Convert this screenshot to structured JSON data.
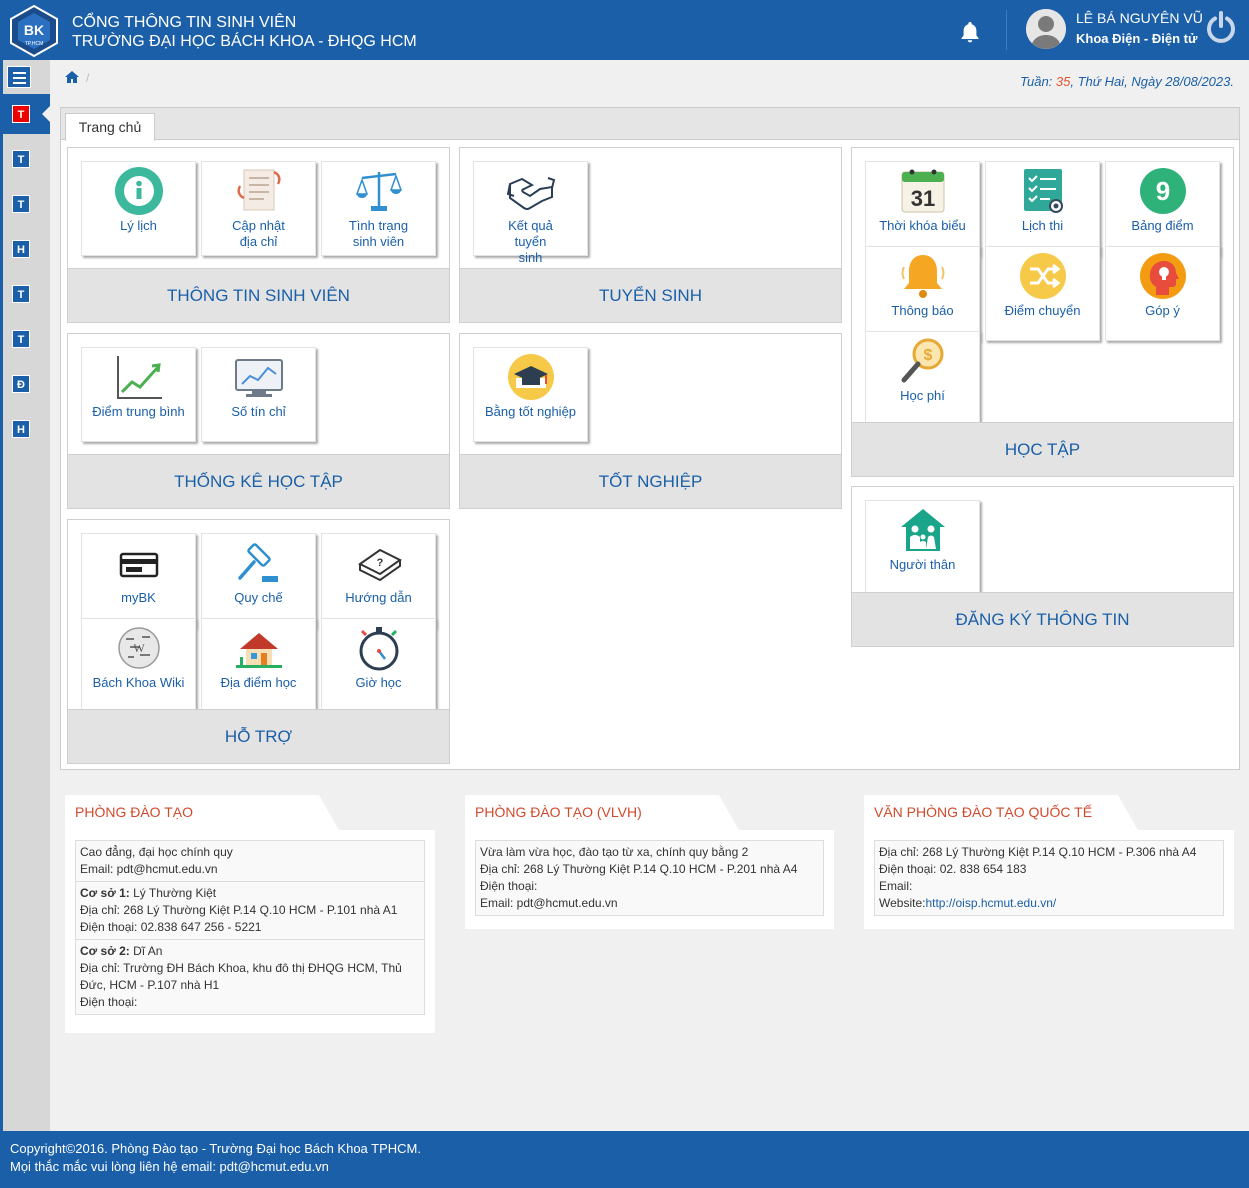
{
  "header": {
    "title_line1": "CỔNG THÔNG TIN SINH VIÊN",
    "title_line2": "TRƯỜNG ĐẠI HỌC BÁCH KHOA - ĐHQG HCM",
    "logo_text": "BK",
    "logo_sub": "TP.HCM",
    "user_name": "LÊ BÁ NGUYÊN VŨ",
    "user_dept": "Khoa Điện - Điện tử"
  },
  "sidebar": {
    "items": [
      "T",
      "T",
      "T",
      "H",
      "T",
      "T",
      "Đ",
      "H"
    ]
  },
  "breadcrumb": {
    "separator": "/"
  },
  "week_info": {
    "prefix": "Tuần: ",
    "week": "35",
    "suffix": ", Thứ Hai, Ngày 28/08/2023."
  },
  "tab": {
    "label": "Trang chủ"
  },
  "cards": {
    "student_info": {
      "title": "THÔNG TIN SINH VIÊN",
      "tiles": [
        "Lý lịch",
        "Cập nhật địa chỉ",
        "Tình trạng sinh viên"
      ]
    },
    "admission": {
      "title": "TUYỂN SINH",
      "tiles": [
        "Kết quả tuyển sinh"
      ]
    },
    "study": {
      "title": "HỌC TẬP",
      "tiles": [
        "Thời khóa biểu",
        "Lịch thi",
        "Bảng điểm",
        "Thông báo",
        "Điểm chuyển",
        "Góp ý",
        "Học phí"
      ]
    },
    "statistics": {
      "title": "THỐNG KÊ HỌC TẬP",
      "tiles": [
        "Điểm trung bình",
        "Số tín chỉ"
      ]
    },
    "graduation": {
      "title": "TỐT NGHIỆP",
      "tiles": [
        "Bằng tốt nghiệp"
      ]
    },
    "register": {
      "title": "ĐĂNG KÝ THÔNG TIN",
      "tiles": [
        "Người thân"
      ]
    },
    "support": {
      "title": "HỖ TRỢ",
      "tiles": [
        "myBK",
        "Quy chế",
        "Hướng dẫn",
        "Bách Khoa Wiki",
        "Địa điểm học",
        "Giờ học"
      ]
    }
  },
  "calendar_day": "31",
  "grade_number": "9",
  "info_boxes": {
    "pdt": {
      "title": "PHÒNG ĐÀO TẠO",
      "s1_l1": "Cao đẳng, đại học chính quy",
      "s1_l2": "Email: pdt@hcmut.edu.vn",
      "s2_head": "Cơ sở 1:",
      "s2_head_val": " Lý Thường Kiệt",
      "s2_l2": "Địa chỉ: 268 Lý Thường Kiệt P.14 Q.10 HCM - P.101 nhà A1",
      "s2_l3": "Điện thoại: 02.838 647 256 - 5221",
      "s3_head": "Cơ sở 2:",
      "s3_head_val": " Dĩ An",
      "s3_l2": "Địa chỉ: Trường ĐH Bách Khoa, khu đô thị ĐHQG HCM, Thủ Đức, HCM - P.107 nhà H1",
      "s3_l3": "Điện thoại:"
    },
    "vlvh": {
      "title": "PHÒNG ĐÀO TẠO (VLVH)",
      "l1": "Vừa làm vừa học, đào tạo từ xa, chính quy bằng 2",
      "l2": "Địa chỉ: 268 Lý Thường Kiệt P.14 Q.10 HCM - P.201 nhà A4",
      "l3": "Điện thoại:",
      "l4": "Email: pdt@hcmut.edu.vn"
    },
    "intl": {
      "title": "VĂN PHÒNG ĐÀO TẠO QUỐC TẾ",
      "l1": "Địa chỉ: 268 Lý Thường Kiệt P.14 Q.10 HCM - P.306 nhà A4",
      "l2": "Điện thoại: 02. 838 654 183",
      "l3": "Email:",
      "l4_label": "Website:",
      "l4_link": "http://oisp.hcmut.edu.vn/"
    }
  },
  "footer": {
    "line1": "Copyright©2016. Phòng Đào tạo - Trường Đại học Bách Khoa TPHCM.",
    "line2": "Mọi thắc mắc vui lòng liên hệ email: pdt@hcmut.edu.vn"
  },
  "colors": {
    "primary": "#1a5fa8",
    "accent_red": "#d24a2c",
    "panel_gray": "#e3e3e3"
  }
}
